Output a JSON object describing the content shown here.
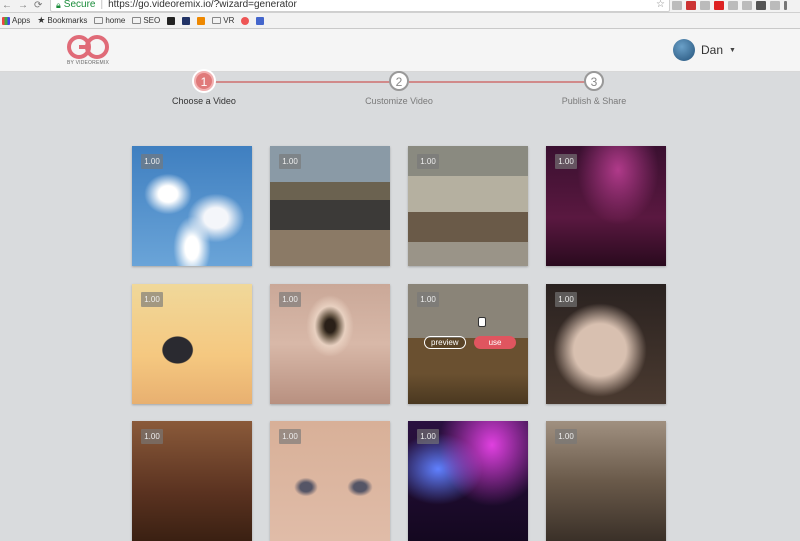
{
  "browser": {
    "secure_label": "Secure",
    "url": "https://go.videoremix.io/?wizard=generator",
    "bookmarks": [
      "Apps",
      "Bookmarks",
      "home",
      "SEO",
      "VR"
    ]
  },
  "app": {
    "logo_sub": "BY VIDEOREMIX",
    "user_name": "Dan"
  },
  "steps": [
    {
      "num": "1",
      "label": "Choose a Video"
    },
    {
      "num": "2",
      "label": "Customize Video"
    },
    {
      "num": "3",
      "label": "Publish & Share"
    }
  ],
  "tiles": [
    {
      "badge": "1.00",
      "scene": "sky-clouds"
    },
    {
      "badge": "1.00",
      "scene": "street-crowd"
    },
    {
      "badge": "1.00",
      "scene": "office-lobby"
    },
    {
      "badge": "1.00",
      "scene": "concert-crowd"
    },
    {
      "badge": "1.00",
      "scene": "silhouette-sunset"
    },
    {
      "badge": "1.00",
      "scene": "eye-closeup"
    },
    {
      "badge": "1.00",
      "scene": "dancing-girl",
      "preview_label": "preview",
      "use_label": "use"
    },
    {
      "badge": "1.00",
      "scene": "man-face"
    },
    {
      "badge": "1.00",
      "scene": "face-closeup-dark"
    },
    {
      "badge": "1.00",
      "scene": "eyes-closeup"
    },
    {
      "badge": "1.00",
      "scene": "stage-lights"
    },
    {
      "badge": "1.00",
      "scene": "beach-people"
    }
  ],
  "colors": {
    "accent": "#e0555f",
    "step_active": "#e07a7a"
  }
}
